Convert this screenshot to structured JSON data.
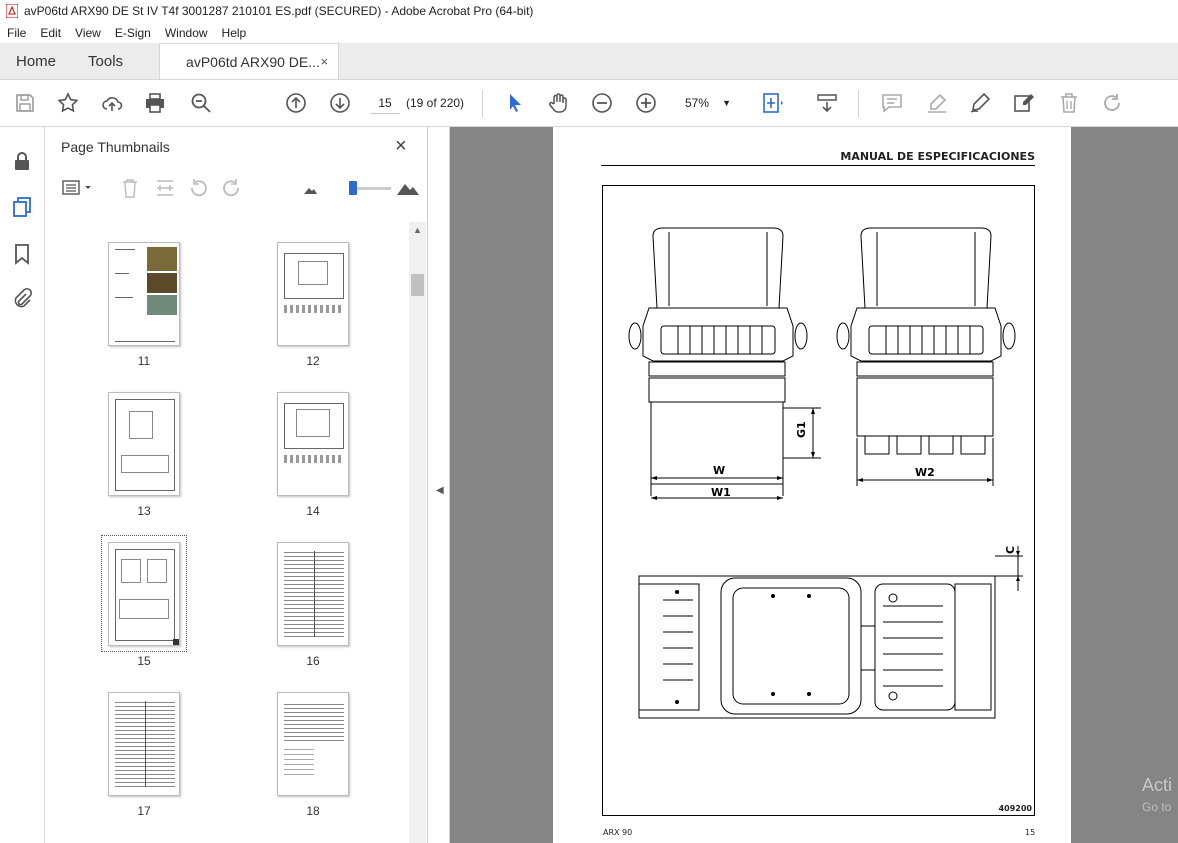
{
  "window": {
    "title": "avP06td ARX90 DE St IV T4f 3001287 210101 ES.pdf (SECURED) - Adobe Acrobat Pro (64-bit)"
  },
  "menu": [
    "File",
    "Edit",
    "View",
    "E-Sign",
    "Window",
    "Help"
  ],
  "tabs": {
    "home": "Home",
    "tools": "Tools",
    "document": "avP06td ARX90 DE...",
    "close": "×"
  },
  "toolbar": {
    "page_number": "15",
    "page_count": "(19 of 220)",
    "zoom": "57%",
    "icons": [
      "save-icon",
      "bookmark-star-icon",
      "upload-icon",
      "print-icon",
      "search-zoom-icon",
      "page-up-icon",
      "page-down-icon",
      "select-cursor-icon",
      "hand-icon",
      "zoom-out-icon",
      "zoom-in-icon",
      "fit-page-icon",
      "scroll-mode-icon",
      "comment-icon",
      "highlight-icon",
      "sign-icon",
      "fill-sign-icon",
      "delete-icon",
      "rotate-icon"
    ]
  },
  "panel": {
    "title": "Page Thumbnails",
    "close": "×",
    "thumbnails": [
      {
        "label": "11"
      },
      {
        "label": "12"
      },
      {
        "label": "13"
      },
      {
        "label": "14"
      },
      {
        "label": "15",
        "selected": true
      },
      {
        "label": "16"
      },
      {
        "label": "17"
      },
      {
        "label": "18"
      }
    ]
  },
  "document_page": {
    "header": "MANUAL DE ESPECIFICACIONES",
    "dimensions": [
      "W",
      "W1",
      "G1",
      "W2",
      "C"
    ],
    "figure_code": "409200",
    "footer_left": "ARX 90",
    "footer_right": "15"
  },
  "overlay": {
    "line1": "Acti",
    "line2": "Go to"
  }
}
